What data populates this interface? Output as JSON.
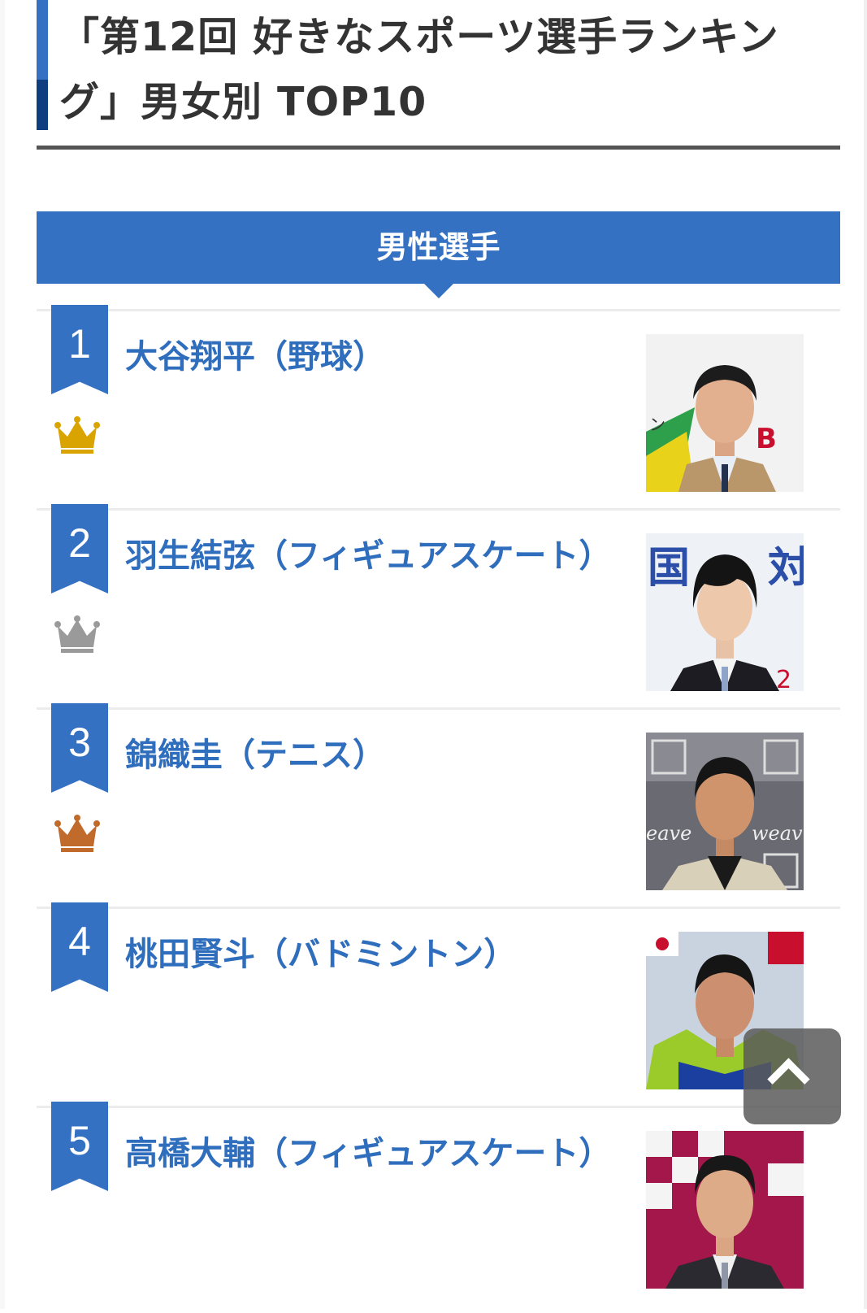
{
  "article": {
    "title": "「第12回 好きなスポーツ選手ランキング」男女別 TOP10"
  },
  "section": {
    "label": "男性選手"
  },
  "rankings": [
    {
      "rank": "1",
      "name": "大谷翔平（野球）",
      "crown": "gold-crown-icon",
      "crown_color": "#d9a400"
    },
    {
      "rank": "2",
      "name": "羽生結弦（フィギュアスケート）",
      "crown": "silver-crown-icon",
      "crown_color": "#9a9a9a"
    },
    {
      "rank": "3",
      "name": "錦織圭（テニス）",
      "crown": "bronze-crown-icon",
      "crown_color": "#c06a2b"
    },
    {
      "rank": "4",
      "name": "桃田賢斗（バドミントン）"
    },
    {
      "rank": "5",
      "name": "高橋大輔（フィギュアスケート）"
    }
  ],
  "controls": {
    "scroll_top_icon": "chevron-up-icon"
  },
  "colors": {
    "accent": "#3571c3",
    "accent_dark": "#0e3d80",
    "link": "#2f6dbd"
  }
}
